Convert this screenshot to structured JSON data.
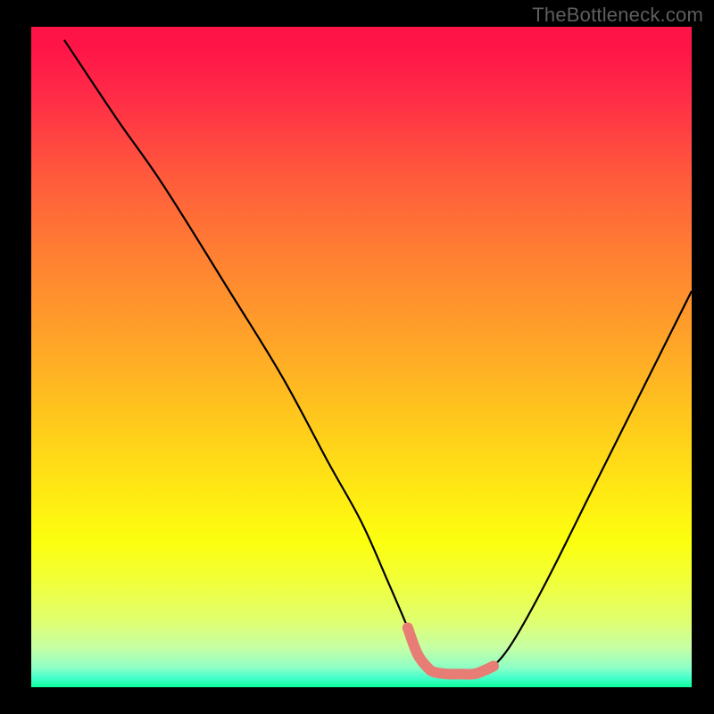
{
  "watermark": "TheBottleneck.com",
  "chart_data": {
    "type": "line",
    "title": "",
    "xlabel": "",
    "ylabel": "",
    "xlim": [
      0,
      100
    ],
    "ylim": [
      0,
      100
    ],
    "series": [
      {
        "name": "curve",
        "color": "#000000",
        "x": [
          5,
          13,
          20,
          30,
          38,
          45,
          50,
          54,
          57,
          58.5,
          60,
          61,
          63,
          65,
          67,
          68.5,
          70,
          73,
          78,
          85,
          92,
          100
        ],
        "y": [
          98,
          86,
          76,
          60,
          47,
          34,
          25,
          16,
          9,
          5,
          3,
          2.3,
          2,
          2,
          2,
          2.5,
          3.2,
          7,
          16,
          30,
          44,
          60
        ]
      },
      {
        "name": "highlight-trough",
        "color": "#e87d75",
        "x": [
          57,
          58.5,
          60,
          61,
          63,
          65,
          67,
          68.5,
          70
        ],
        "y": [
          9,
          5,
          3,
          2.3,
          2,
          2,
          2,
          2.5,
          3.2
        ]
      }
    ],
    "gradient_stops": [
      {
        "pos": 0,
        "color": "#ff1448"
      },
      {
        "pos": 0.1,
        "color": "#ff2a47"
      },
      {
        "pos": 0.23,
        "color": "#ff5b3c"
      },
      {
        "pos": 0.35,
        "color": "#ff8132"
      },
      {
        "pos": 0.48,
        "color": "#ffa528"
      },
      {
        "pos": 0.58,
        "color": "#ffc41e"
      },
      {
        "pos": 0.7,
        "color": "#ffe814"
      },
      {
        "pos": 0.78,
        "color": "#fcff0f"
      },
      {
        "pos": 0.84,
        "color": "#f1ff3a"
      },
      {
        "pos": 0.9,
        "color": "#e0ff70"
      },
      {
        "pos": 0.94,
        "color": "#c6ffa5"
      },
      {
        "pos": 0.97,
        "color": "#8effc5"
      },
      {
        "pos": 0.985,
        "color": "#4affcc"
      },
      {
        "pos": 1.0,
        "color": "#0aff9e"
      }
    ]
  }
}
